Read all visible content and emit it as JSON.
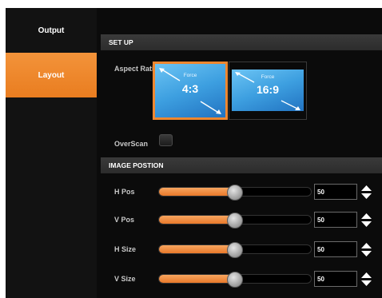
{
  "sidebar": {
    "items": [
      {
        "label": "Output",
        "selected": false
      },
      {
        "label": "Layout",
        "selected": true
      }
    ]
  },
  "setup": {
    "section_title": "SET UP",
    "aspect_ratio_label": "Aspect Ratio",
    "aspect_options": [
      {
        "force_label": "Force",
        "ratio": "4:3",
        "selected": true
      },
      {
        "force_label": "Force",
        "ratio": "16:9",
        "selected": false
      }
    ],
    "overscan_label": "OverScan",
    "overscan_checked": false
  },
  "image_position": {
    "section_title": "IMAGE POSTION",
    "sliders": [
      {
        "label": "H Pos",
        "value": "50",
        "level": 0.5
      },
      {
        "label": "V Pos",
        "value": "50",
        "level": 0.5
      },
      {
        "label": "H Size",
        "value": "50",
        "level": 0.5
      },
      {
        "label": "V Size",
        "value": "50",
        "level": 0.5
      }
    ]
  },
  "colors": {
    "accent": "#ee8730",
    "screen": "#3d9fe0",
    "background": "#0b0b0b"
  }
}
